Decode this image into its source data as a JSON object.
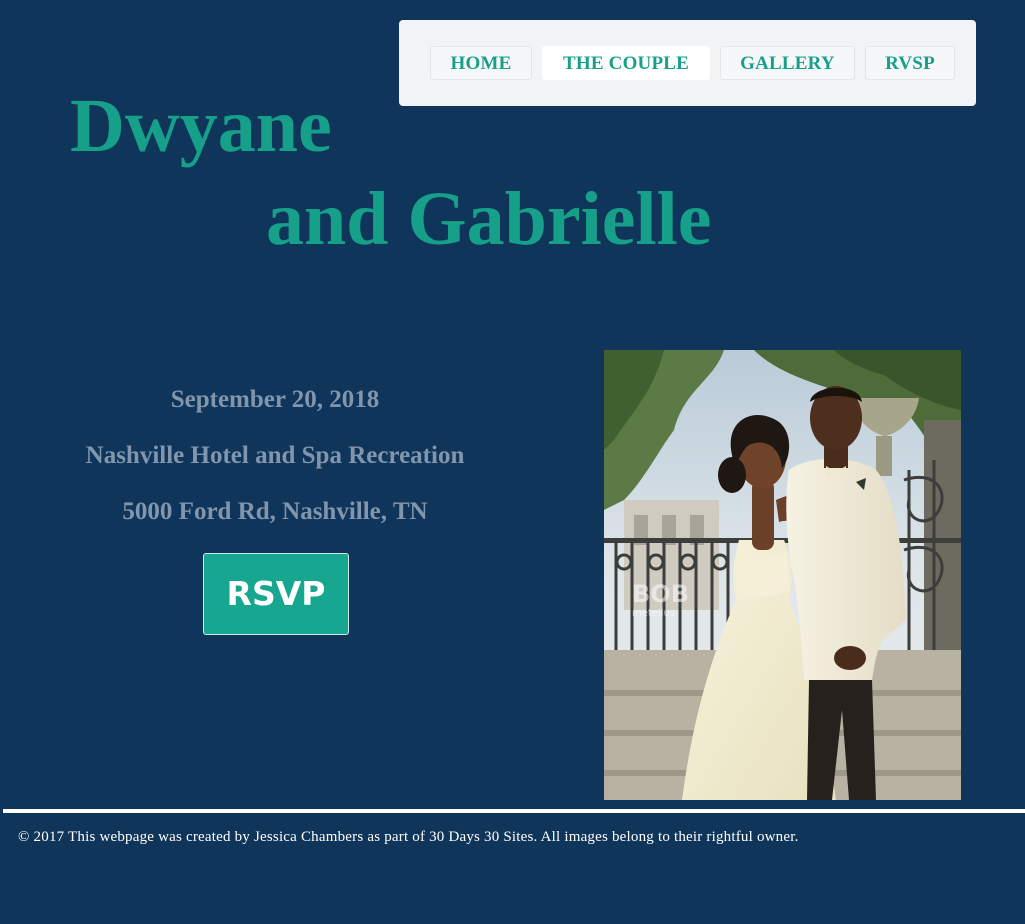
{
  "nav": {
    "items": [
      {
        "label": "HOME"
      },
      {
        "label": "THE COUPLE"
      },
      {
        "label": "GALLERY"
      },
      {
        "label": "RVSP"
      }
    ],
    "active": "THE COUPLE"
  },
  "hero": {
    "title_line1": "Dwyane",
    "title_line2": "and Gabrielle"
  },
  "event": {
    "date": "September 20, 2018",
    "venue": "Nashville Hotel and Spa Recreation",
    "address": "5000 Ford Rd, Nashville, TN",
    "rsvp_label": "RSVP"
  },
  "photo": {
    "watermark": "BOB metellus"
  },
  "footer": {
    "text": "© 2017 This webpage was created by Jessica Chambers as part of 30 Days 30 Sites. All images belong to their rightful owner."
  },
  "colors": {
    "background": "#10355a",
    "accent": "#16a08a",
    "detail_text": "#8196ad",
    "nav_background": "#f2f3f5"
  }
}
